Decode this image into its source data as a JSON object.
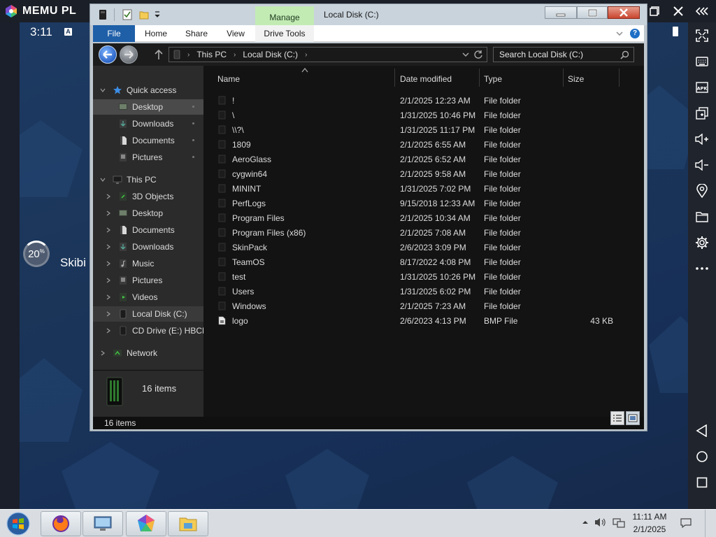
{
  "emulator": {
    "brand": "MEMU PL"
  },
  "android": {
    "status_time": "3:11",
    "status_badge": "A",
    "ring_value": "20",
    "ring_unit": "%",
    "app_label": "Skibi"
  },
  "explorer": {
    "title": "Local Disk (C:)",
    "manage_tab": "Manage",
    "ribbon_tabs": [
      "File",
      "Home",
      "Share",
      "View",
      "Drive Tools"
    ],
    "breadcrumb": [
      "This PC",
      "Local Disk (C:)"
    ],
    "search_placeholder": "Search Local Disk (C:)",
    "columns": [
      "Name",
      "Date modified",
      "Type",
      "Size"
    ],
    "nav": {
      "quick_access": "Quick access",
      "quick_items": [
        "Desktop",
        "Downloads",
        "Documents",
        "Pictures"
      ],
      "this_pc": "This PC",
      "pc_items": [
        "3D Objects",
        "Desktop",
        "Documents",
        "Downloads",
        "Music",
        "Pictures",
        "Videos",
        "Local Disk (C:)",
        "CD Drive (E:) HBCD_"
      ],
      "network": "Network"
    },
    "files": [
      {
        "name": "!",
        "date": "2/1/2025 12:23 AM",
        "type": "File folder",
        "size": ""
      },
      {
        "name": "\\",
        "date": "1/31/2025 10:46 PM",
        "type": "File folder",
        "size": ""
      },
      {
        "name": "\\\\?\\",
        "date": "1/31/2025 11:17 PM",
        "type": "File folder",
        "size": ""
      },
      {
        "name": "1809",
        "date": "2/1/2025 6:55 AM",
        "type": "File folder",
        "size": ""
      },
      {
        "name": "AeroGlass",
        "date": "2/1/2025 6:52 AM",
        "type": "File folder",
        "size": ""
      },
      {
        "name": "cygwin64",
        "date": "2/1/2025 9:58 AM",
        "type": "File folder",
        "size": ""
      },
      {
        "name": "MININT",
        "date": "1/31/2025 7:02 PM",
        "type": "File folder",
        "size": ""
      },
      {
        "name": "PerfLogs",
        "date": "9/15/2018 12:33 AM",
        "type": "File folder",
        "size": ""
      },
      {
        "name": "Program Files",
        "date": "2/1/2025 10:34 AM",
        "type": "File folder",
        "size": ""
      },
      {
        "name": "Program Files (x86)",
        "date": "2/1/2025 7:08 AM",
        "type": "File folder",
        "size": ""
      },
      {
        "name": "SkinPack",
        "date": "2/6/2023 3:09 PM",
        "type": "File folder",
        "size": ""
      },
      {
        "name": "TeamOS",
        "date": "8/17/2022 4:08 PM",
        "type": "File folder",
        "size": ""
      },
      {
        "name": "test",
        "date": "1/31/2025 10:26 PM",
        "type": "File folder",
        "size": ""
      },
      {
        "name": "Users",
        "date": "1/31/2025 6:02 PM",
        "type": "File folder",
        "size": ""
      },
      {
        "name": "Windows",
        "date": "2/1/2025 7:23 AM",
        "type": "File folder",
        "size": ""
      },
      {
        "name": "logo",
        "date": "2/6/2023 4:13 PM",
        "type": "BMP File",
        "size": "43 KB"
      }
    ],
    "details_count": "16 items",
    "status_count": "16 items"
  },
  "taskbar": {
    "time": "11:11 AM",
    "date": "2/1/2025"
  },
  "icons": {
    "emulator": [
      "memu-logo-icon",
      "restore-icon",
      "close-icon",
      "collapse-icon"
    ],
    "sidebar": [
      "fullscreen-icon",
      "keyboard-icon",
      "apk-icon",
      "add-window-icon",
      "volume-up-icon",
      "volume-down-icon",
      "location-icon",
      "folder-icon",
      "settings-icon",
      "more-icon",
      "back-icon",
      "home-icon",
      "recents-icon"
    ]
  },
  "colors": {
    "file_tab": "#1f5fa8",
    "manage_tab": "#c2ebb4",
    "close_button": "#c9452e",
    "content_bg": "#131313",
    "navpane_bg": "#2b2b2b"
  }
}
